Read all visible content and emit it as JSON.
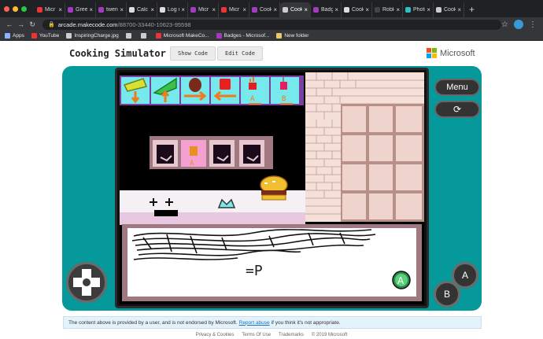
{
  "browser": {
    "tabs": [
      {
        "label": "Micr",
        "favcolor": "#e33"
      },
      {
        "label": "Gree",
        "favcolor": "#a33bbf"
      },
      {
        "label": "twen",
        "favcolor": "#a33bbf"
      },
      {
        "label": "Calc",
        "favcolor": "#ddd"
      },
      {
        "label": "Log i",
        "favcolor": "#ddd"
      },
      {
        "label": "Micr",
        "favcolor": "#a33bbf"
      },
      {
        "label": "Micr",
        "favcolor": "#e33"
      },
      {
        "label": "Cook",
        "favcolor": "#a33bbf"
      },
      {
        "label": "Cook",
        "favcolor": "#ccc",
        "active": true
      },
      {
        "label": "Badg",
        "favcolor": "#a33bbf"
      },
      {
        "label": "Cook",
        "favcolor": "#ddd"
      },
      {
        "label": "Roblo",
        "favcolor": "#444"
      },
      {
        "label": "Photo",
        "favcolor": "#30c0c0"
      },
      {
        "label": "Cook",
        "favcolor": "#ccc"
      }
    ],
    "url_host": "arcade.makecode.com",
    "url_path": "/88700-33440-10623-95598",
    "bookmarks": [
      {
        "label": "Apps",
        "color": "#8ab4f8"
      },
      {
        "label": "YouTube",
        "color": "#e33"
      },
      {
        "label": "InspiringCharge.jpg",
        "color": "#ccc"
      },
      {
        "label": "",
        "color": "#ccc"
      },
      {
        "label": "",
        "color": "#ccc"
      },
      {
        "label": "Microsoft MakeCo...",
        "color": "#e33"
      },
      {
        "label": "Badges - Microsof...",
        "color": "#a33bbf"
      },
      {
        "label": "New folder",
        "color": "#e8c86a"
      }
    ]
  },
  "header": {
    "title": "Cooking Simulator",
    "show_code": "Show Code",
    "edit_code": "Edit Code",
    "brand": "Microsoft"
  },
  "simulator": {
    "menu_label": "Menu",
    "a_label": "A",
    "b_label": "B",
    "dialog_text": "=P"
  },
  "notice": {
    "before": "The content above is provided by a user, and is not endorsed by Microsoft.",
    "link": "Report abuse",
    "after": "if you think it's not appropriate."
  },
  "footer": {
    "links": [
      "Privacy & Cookies",
      "Terms Of Use",
      "Trademarks",
      "© 2019 Microsoft"
    ]
  },
  "colors": {
    "sim_bg": "#05999c",
    "tile_bg": "#77e8ec",
    "counter": "#e8c8e0",
    "wall": "#f0d8d0"
  }
}
